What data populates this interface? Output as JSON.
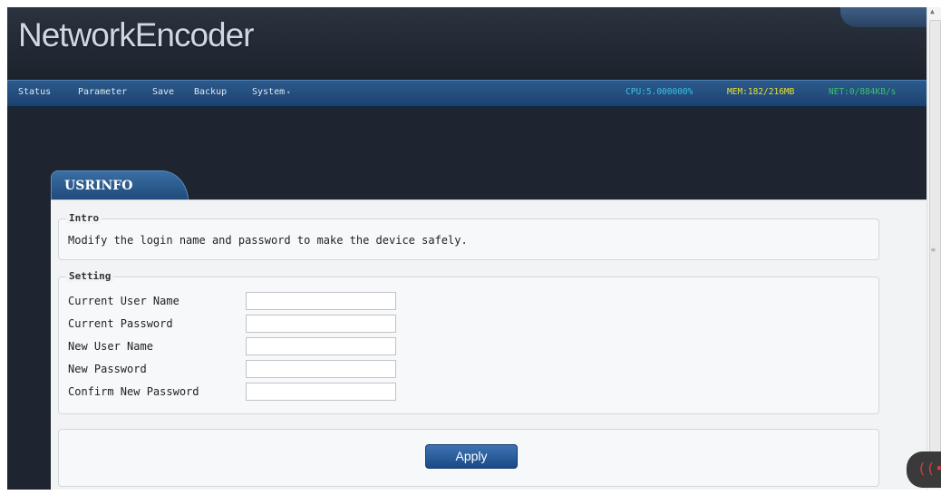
{
  "header": {
    "logo": "NetworkEncoder"
  },
  "nav": {
    "items": [
      "Status",
      "Parameter",
      "Save",
      "Backup",
      "System"
    ],
    "dropdown_arrow": "▾"
  },
  "stats": {
    "cpu": "CPU:5.000000%",
    "mem": "MEM:182/216MB",
    "net": "NET:0/884KB/s",
    "colors": {
      "cpu": "#38c4e6",
      "mem": "#e6e03a",
      "net": "#38c46a"
    }
  },
  "tab": {
    "label": "USRINFO"
  },
  "intro": {
    "legend": "Intro",
    "text": "Modify the login name and password to make the device safely."
  },
  "setting": {
    "legend": "Setting",
    "fields": [
      {
        "label": "Current User Name",
        "value": ""
      },
      {
        "label": "Current Password",
        "value": ""
      },
      {
        "label": "New User Name",
        "value": ""
      },
      {
        "label": "New Password",
        "value": ""
      },
      {
        "label": "Confirm New Password",
        "value": ""
      }
    ]
  },
  "actions": {
    "apply_label": "Apply"
  },
  "icons": {
    "wifi": "wifi-icon",
    "scroll_up": "scroll-up-arrow-icon"
  }
}
